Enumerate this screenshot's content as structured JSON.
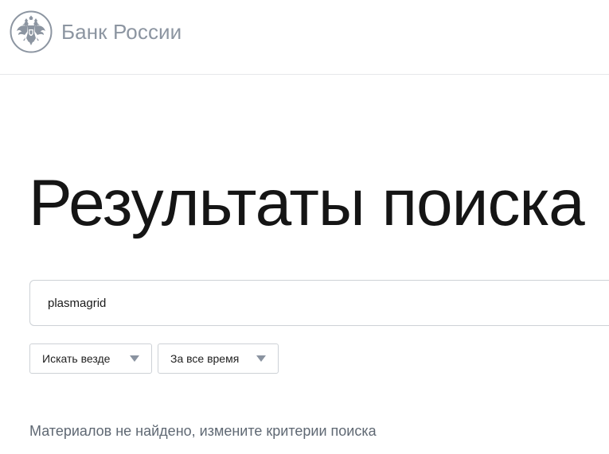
{
  "header": {
    "logo_text": "Банк России",
    "emblem_icon": "double-headed-eagle-icon"
  },
  "main": {
    "title": "Результаты поиска",
    "search": {
      "value": "plasmagrid",
      "placeholder": ""
    },
    "filters": [
      {
        "label": "Искать везде",
        "icon": "caret-down-icon"
      },
      {
        "label": "За все время",
        "icon": "caret-down-icon"
      }
    ],
    "status_text": "Материалов не найдено, измените критерии поиска"
  },
  "colors": {
    "logo_gray": "#8c95a1",
    "border": "#cdd1d6",
    "title": "#151515",
    "muted_text": "#5f6873"
  }
}
